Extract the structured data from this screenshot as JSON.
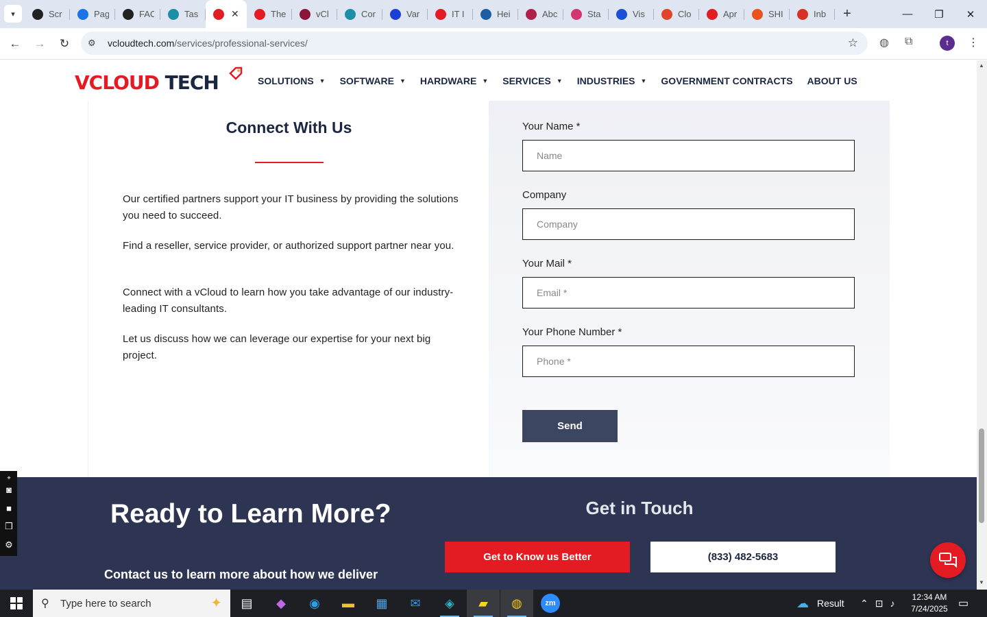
{
  "browser": {
    "tabs": [
      {
        "label": "Scr",
        "icon": "screencast-icon",
        "color": "#222222"
      },
      {
        "label": "Pag",
        "icon": "pagespeed-icon",
        "color": "#1a73e8"
      },
      {
        "label": "FAC",
        "icon": "openai-icon",
        "color": "#222222"
      },
      {
        "label": "Tas",
        "icon": "task-icon",
        "color": "#1a8fa6"
      },
      {
        "label": "",
        "icon": "vcloud-logo-icon",
        "color": "#e31b23",
        "active": true
      },
      {
        "label": "The",
        "icon": "vcloud-logo-icon",
        "color": "#e31b23"
      },
      {
        "label": "vCl",
        "icon": "v-logo-icon",
        "color": "#8a1538"
      },
      {
        "label": "Cor",
        "icon": "task-icon",
        "color": "#1a8fa6"
      },
      {
        "label": "Var",
        "icon": "x-logo-icon",
        "color": "#1c3fd6"
      },
      {
        "label": "IT I",
        "icon": "vcloud-logo-icon",
        "color": "#e31b23"
      },
      {
        "label": "Hei",
        "icon": "scale-icon",
        "color": "#1a5fa6"
      },
      {
        "label": "Abc",
        "icon": "abc-logo-icon",
        "color": "#b0204a"
      },
      {
        "label": "Sta",
        "icon": "pen-logo-icon",
        "color": "#d2356f"
      },
      {
        "label": "Vis",
        "icon": "pulse-logo-icon",
        "color": "#1a4fd6"
      },
      {
        "label": "Clo",
        "icon": "swoosh-logo-icon",
        "color": "#e0442a"
      },
      {
        "label": "Apr",
        "icon": "vcloud-logo-icon",
        "color": "#e31b23"
      },
      {
        "label": "SHI",
        "icon": "ring-logo-icon",
        "color": "#e8541c"
      },
      {
        "label": "Inb",
        "icon": "gmail-icon",
        "color": "#d93025"
      }
    ],
    "close_tab": "✕",
    "new_tab": "+",
    "url_host": "vcloudtech.com",
    "url_path": "/services/professional-services/"
  },
  "site": {
    "logo": {
      "part1": "VCLOUD",
      "part2": "TECH"
    },
    "nav": [
      {
        "label": "SOLUTIONS",
        "has_caret": true
      },
      {
        "label": "SOFTWARE",
        "has_caret": true
      },
      {
        "label": "HARDWARE",
        "has_caret": true
      },
      {
        "label": "SERVICES",
        "has_caret": true
      },
      {
        "label": "INDUSTRIES",
        "has_caret": true
      },
      {
        "label": "GOVERNMENT CONTRACTS",
        "has_caret": false
      },
      {
        "label": "ABOUT US",
        "has_caret": false
      }
    ],
    "connect": {
      "title": "Connect With Us",
      "paragraphs": [
        "Our certified partners support your IT business by providing the solutions you need to succeed.",
        "Find a reseller, service provider, or authorized support partner near you.",
        "Connect with a vCloud to learn how you take advantage of our industry-leading IT consultants.",
        "Let us discuss how we can leverage our expertise for your next big project."
      ]
    },
    "form": {
      "name_label": "Your Name *",
      "name_placeholder": "Name",
      "company_label": "Company",
      "company_placeholder": "Company",
      "mail_label": "Your Mail *",
      "mail_placeholder": "Email *",
      "phone_label": "Your Phone Number *",
      "phone_placeholder": "Phone *",
      "send_label": "Send"
    },
    "footer": {
      "ready_title": "Ready to Learn More?",
      "contact_line": "Contact us to learn more about how we deliver",
      "get_in_touch": "Get in Touch",
      "know_us_button": "Get to Know us Better",
      "phone_button": "(833) 482-5683"
    }
  },
  "taskbar": {
    "search_placeholder": "Type here to search",
    "weather_label": "Result",
    "time": "12:34 AM",
    "date": "7/24/2025"
  },
  "colors": {
    "brand_red": "#e31b23",
    "brand_navy": "#1b2642",
    "footer_bg": "#2e3552",
    "send_button": "#3d4660"
  }
}
